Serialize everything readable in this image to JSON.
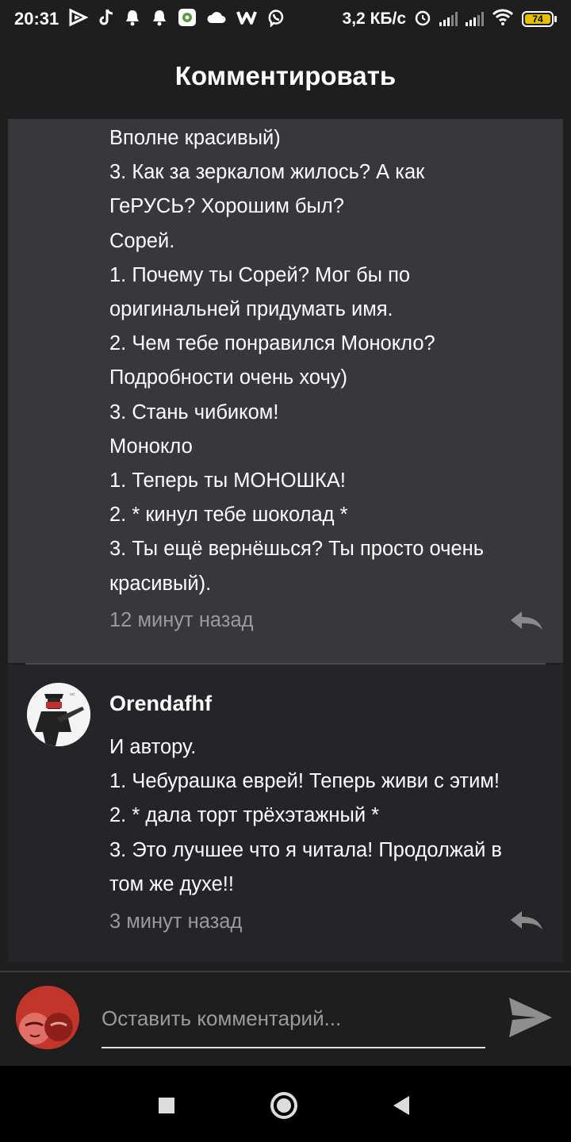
{
  "status_bar": {
    "time": "20:31",
    "speed": "3,2 КБ/с",
    "battery": "74"
  },
  "header": {
    "title": "Комментировать"
  },
  "comments": [
    {
      "lines": [
        "Вполне красивый)",
        "3. Как за зеркалом жилось? А как",
        "ГеРУСЬ? Хорошим был?",
        "Сорей.",
        "1. Почему ты Сорей? Мог бы по",
        "оригинальней придумать имя.",
        "2. Чем тебе понравился Монокло?",
        "Подробности очень хочу)",
        "3. Стань чибиком!",
        "Монокло",
        "1. Теперь ты МОНОШКА!",
        "2. * кинул тебе шоколад *",
        "3. Ты ещё вернёшься? Ты просто очень",
        "красивый)."
      ],
      "time": "12 минут назад"
    },
    {
      "author": "Orendafhf",
      "lines": [
        "И автору.",
        "1. Чебурашка еврей! Теперь живи с этим!",
        "2. * дала торт трёхэтажный *",
        "3. Это лучшее что я читала! Продолжай в",
        "том же духе!!"
      ],
      "time": "3 минут назад"
    }
  ],
  "input": {
    "placeholder": "Оставить комментарий..."
  },
  "icons": {
    "reply": "reply-arrow-icon",
    "send": "send-icon",
    "nav": [
      "square-icon",
      "circle-home-icon",
      "back-triangle-icon"
    ]
  },
  "colors": {
    "background": "#1e1e1e",
    "card_highlight": "#38373b",
    "card": "#252429",
    "muted_text": "#9a9a9a",
    "battery": "#e5c000"
  }
}
